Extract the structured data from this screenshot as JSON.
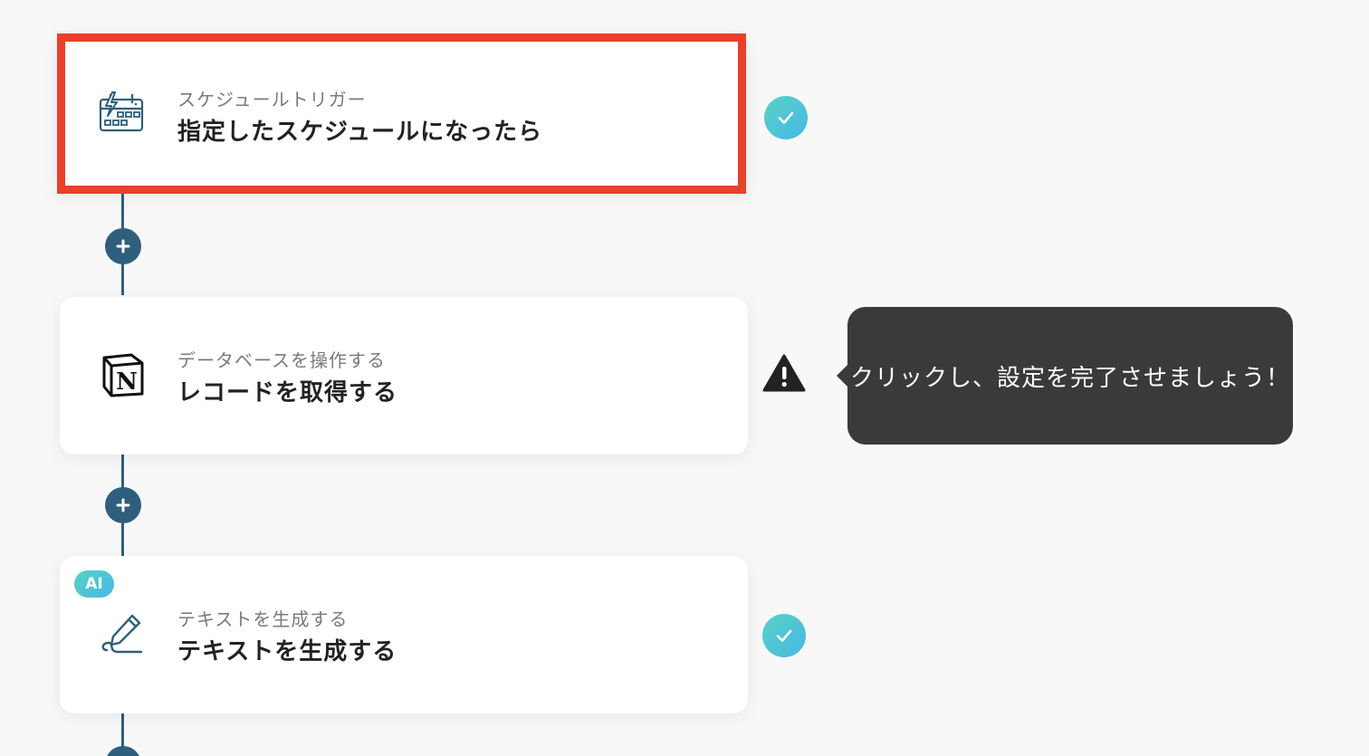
{
  "steps": [
    {
      "category": "スケジュールトリガー",
      "title": "指定したスケジュールになったら",
      "icon": "calendar-lightning-icon",
      "status": "complete"
    },
    {
      "category": "データベースを操作する",
      "title": "レコードを取得する",
      "icon": "notion-logo-icon",
      "icon_text": "N",
      "status": "warning"
    },
    {
      "category": "テキストを生成する",
      "title": "テキストを生成する",
      "icon": "pen-scribble-icon",
      "badge": "AI",
      "status": "complete"
    }
  ],
  "tooltip": {
    "text": "クリックし、設定を完了させましょう！"
  },
  "colors": {
    "accent": "#e8402a",
    "connector": "#2e5f7d",
    "check_gradient_start": "#5bd2c6",
    "check_gradient_end": "#44b8e4",
    "tooltip_bg": "#3a3a3a"
  }
}
